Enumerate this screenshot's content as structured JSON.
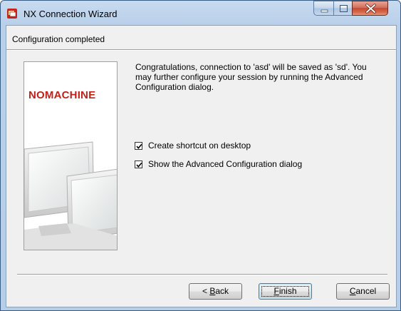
{
  "window": {
    "title": "NX Connection Wizard",
    "icon": "nx-app-icon",
    "controls": [
      "minimize-icon",
      "maximize-icon",
      "close-icon"
    ]
  },
  "header": {
    "title": "Configuration completed"
  },
  "banner": {
    "logo_text": "NOMACHINE",
    "accent": "#c0221a"
  },
  "content": {
    "message": "Congratulations, connection to 'asd' will be saved as 'sd'. You may further configure your session by running the Advanced Configuration dialog."
  },
  "options": [
    {
      "label": "Create shortcut on desktop",
      "checked": true
    },
    {
      "label": "Show the Advanced Configuration dialog",
      "checked": true
    }
  ],
  "buttons": {
    "back": {
      "prefix": "< ",
      "mnemonic": "B",
      "rest": "ack"
    },
    "finish": {
      "prefix": "",
      "mnemonic": "F",
      "rest": "inish"
    },
    "cancel": {
      "prefix": "",
      "mnemonic": "C",
      "rest": "ancel"
    }
  }
}
